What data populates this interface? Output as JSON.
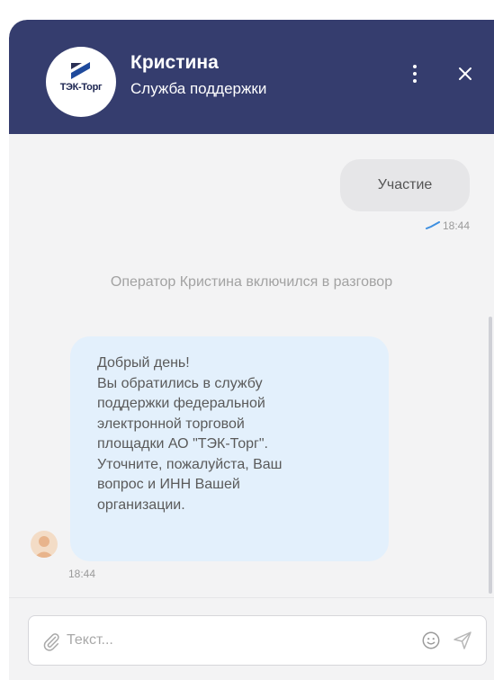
{
  "header": {
    "agent_name": "Кристина",
    "agent_role": "Служба поддержки",
    "logo_text": "ТЭК-Торг",
    "background_color": "#353d6e"
  },
  "messages": {
    "outgoing": {
      "text": "Участие",
      "time": "18:44"
    },
    "system": {
      "text": "Оператор Кристина включился в разговор"
    },
    "incoming": {
      "lines": [
        "Добрый день!",
        "Вы обратились в службу",
        "поддержки федеральной",
        "электронной торговой",
        "площадки АО \"ТЭК-Торг\".",
        "Уточните, пожалуйста, Ваш",
        "вопрос и ИНН Вашей",
        "организации."
      ],
      "time": "18:44"
    }
  },
  "composer": {
    "placeholder": "Текст..."
  },
  "icons": {
    "menu": "more-vertical-icon",
    "close": "close-icon",
    "read_status": "check-icon",
    "attach": "paperclip-icon",
    "emoji": "smiley-icon",
    "send": "send-icon"
  }
}
